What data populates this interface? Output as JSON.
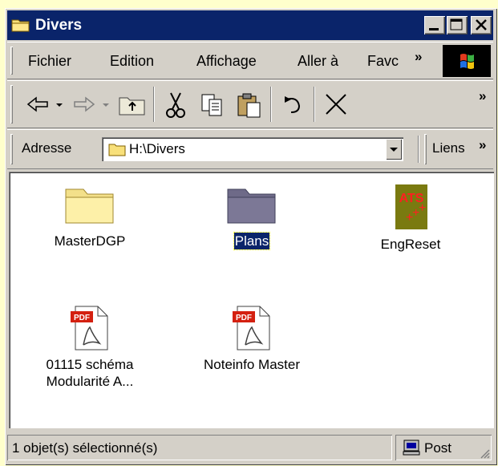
{
  "window": {
    "title": "Divers"
  },
  "menu": {
    "items": [
      {
        "label": "Fichier"
      },
      {
        "label": "Edition"
      },
      {
        "label": "Affichage"
      },
      {
        "label": "Aller à"
      },
      {
        "label": "Favc"
      }
    ],
    "overflow": "»"
  },
  "toolbar": {
    "overflow": "»"
  },
  "address": {
    "label": "Adresse",
    "value": "H:\\Divers",
    "links_label": "Liens",
    "links_overflow": "»"
  },
  "items": [
    {
      "name": "MasterDGP",
      "icon": "folder-icon",
      "selected": false
    },
    {
      "name": "Plans",
      "icon": "folder-icon",
      "selected": true
    },
    {
      "name": "EngReset",
      "icon": "ats-app-icon",
      "selected": false
    },
    {
      "name": "01115 schéma\nModularité A...",
      "icon": "pdf-icon",
      "selected": false
    },
    {
      "name": "Noteinfo Master",
      "icon": "pdf-icon",
      "selected": false
    }
  ],
  "ats_icon_text": "ATS",
  "pdf_badge": "PDF",
  "status": {
    "text": "1 objet(s) sélectionné(s)",
    "zone": "Post"
  },
  "colors": {
    "titlebar": "#0a246a",
    "face": "#d4d0c8",
    "background": "#ffffcc"
  }
}
